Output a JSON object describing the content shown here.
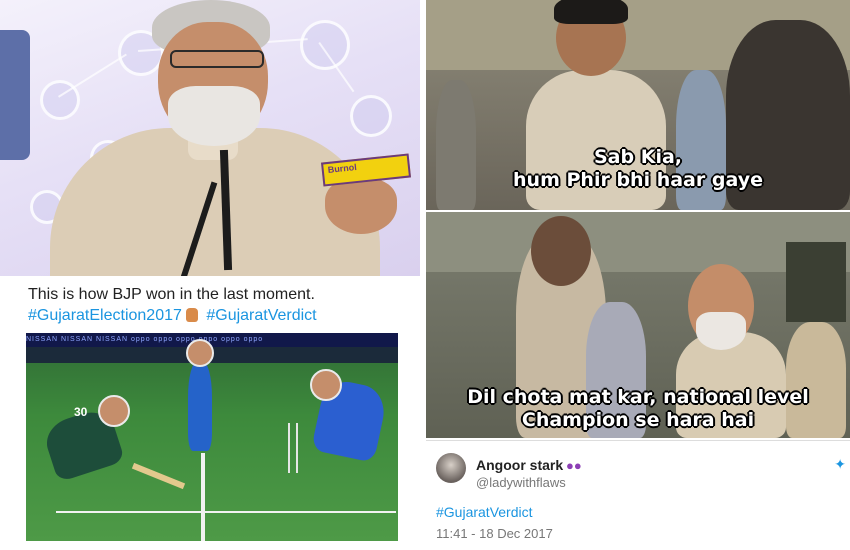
{
  "left_tweet": {
    "text": "This is how BJP won in the last moment.",
    "hashtag1": "#GujaratElection2017",
    "hashtag2": "#GujaratVerdict"
  },
  "product_box_text": "Burnol",
  "stadium_ad_text": "NISSAN NISSAN NISSAN oppo oppo oppo oppo oppo oppo",
  "jersey_number": "30",
  "meme_top": {
    "line1": "Sab Kia,",
    "line2": "hum Phir bhi haar gaye"
  },
  "meme_bottom": {
    "line1": "Dil chota mat kar, national level",
    "line2": "Champion se hara hai"
  },
  "right_tweet": {
    "name": "Angoor stark",
    "emoji_icon": "grapes-icon",
    "handle": "@ladywithflaws",
    "hashtag": "#GujaratVerdict",
    "timestamp": "11:41 - 18 Dec 2017"
  },
  "colors": {
    "hashtag_blue": "#1b95e0",
    "meme_text": "#ffffff",
    "stroke": "#000000"
  }
}
